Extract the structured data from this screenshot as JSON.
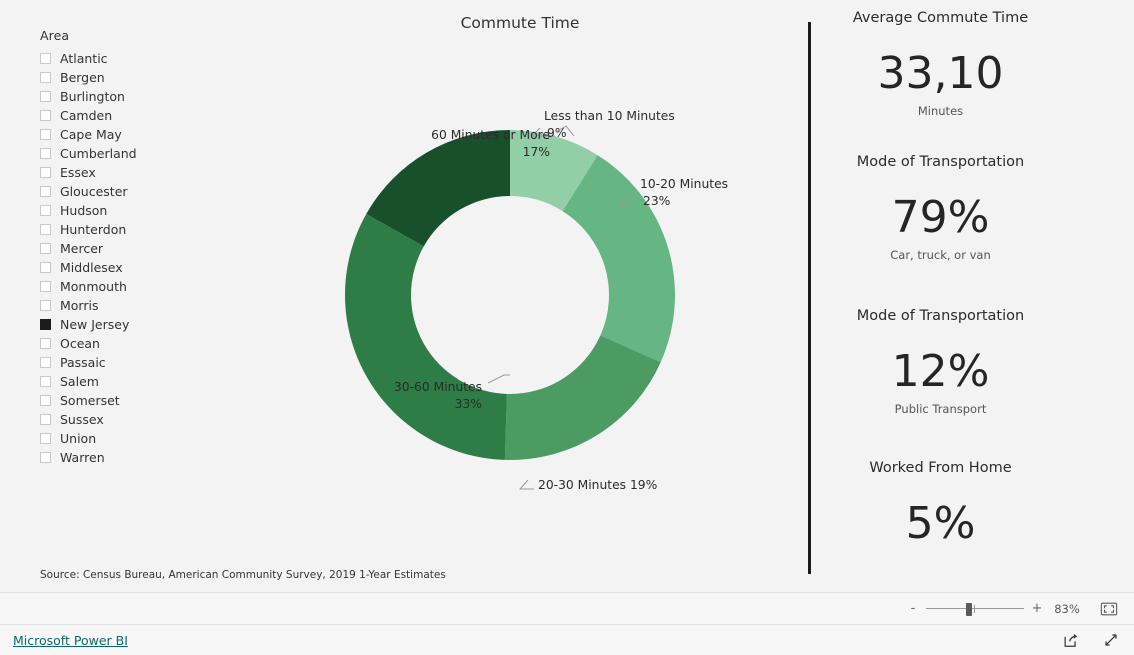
{
  "report": {
    "background": "#f3f3f3",
    "source_note": "Source: Census Bureau, American Community Survey, 2019 1-Year Estimates"
  },
  "slicer": {
    "title": "Area",
    "items": [
      {
        "label": "Atlantic",
        "selected": false
      },
      {
        "label": "Bergen",
        "selected": false
      },
      {
        "label": "Burlington",
        "selected": false
      },
      {
        "label": "Camden",
        "selected": false
      },
      {
        "label": "Cape May",
        "selected": false
      },
      {
        "label": "Cumberland",
        "selected": false
      },
      {
        "label": "Essex",
        "selected": false
      },
      {
        "label": "Gloucester",
        "selected": false
      },
      {
        "label": "Hudson",
        "selected": false
      },
      {
        "label": "Hunterdon",
        "selected": false
      },
      {
        "label": "Mercer",
        "selected": false
      },
      {
        "label": "Middlesex",
        "selected": false
      },
      {
        "label": "Monmouth",
        "selected": false
      },
      {
        "label": "Morris",
        "selected": false
      },
      {
        "label": "New Jersey",
        "selected": true
      },
      {
        "label": "Ocean",
        "selected": false
      },
      {
        "label": "Passaic",
        "selected": false
      },
      {
        "label": "Salem",
        "selected": false
      },
      {
        "label": "Somerset",
        "selected": false
      },
      {
        "label": "Sussex",
        "selected": false
      },
      {
        "label": "Union",
        "selected": false
      },
      {
        "label": "Warren",
        "selected": false
      }
    ]
  },
  "chart_data": {
    "type": "pie",
    "title": "Commute Time",
    "donut": true,
    "inner_radius_ratio": 0.6,
    "legend": "none",
    "labels_on_slices": true,
    "categories": [
      "Less than 10 Minutes",
      "10-20 Minutes",
      "20-30 Minutes",
      "30-60 Minutes",
      "60 Minutes or More"
    ],
    "values": [
      9,
      23,
      19,
      33,
      17
    ],
    "value_labels": [
      "9%",
      "23%",
      "19%",
      "33%",
      "17%"
    ],
    "colors": [
      "#92cfa8",
      "#66b683",
      "#4c9b62",
      "#2e7d46",
      "#17502a"
    ],
    "callouts": [
      {
        "category": "Less than 10 Minutes",
        "percent": "9%",
        "line1": "Less than 10 Minutes",
        "line2": "9%"
      },
      {
        "category": "10-20 Minutes",
        "percent": "23%",
        "line1": "10-20 Minutes",
        "line2": "23%"
      },
      {
        "category": "20-30 Minutes",
        "percent": "19%",
        "line1": "20-30 Minutes 19%",
        "line2": ""
      },
      {
        "category": "30-60 Minutes",
        "percent": "33%",
        "line1": "30-60 Minutes",
        "line2": "33%"
      },
      {
        "category": "60 Minutes or More",
        "percent": "17%",
        "line1": "60 Minutes or More",
        "line2": "17%"
      }
    ]
  },
  "kpis": [
    {
      "title": "Average Commute Time",
      "value": "33,10",
      "sub": "Minutes"
    },
    {
      "title": "Mode of Transportation",
      "value": "79%",
      "sub": "Car, truck, or van"
    },
    {
      "title": "Mode of Transportation",
      "value": "12%",
      "sub": "Public Transport"
    },
    {
      "title": "Worked From Home",
      "value": "5%",
      "sub": ""
    }
  ],
  "zoom_bar": {
    "minus": "-",
    "plus": "+",
    "level": "83%",
    "fit_icon": "fit-to-page-icon"
  },
  "footer": {
    "link": "Microsoft Power BI",
    "share_icon": "share-icon",
    "fullscreen_icon": "fullscreen-icon"
  }
}
